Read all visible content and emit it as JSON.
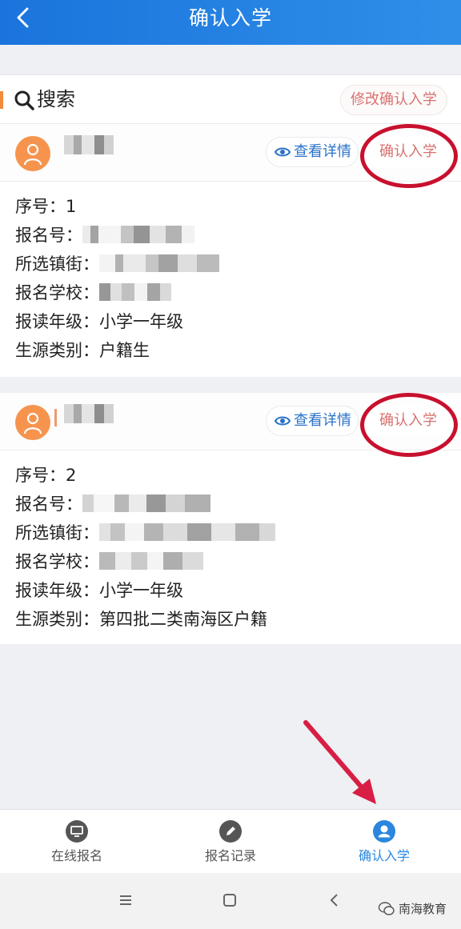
{
  "header": {
    "title": "确认入学"
  },
  "search": {
    "label": "搜索",
    "modify_button": "修改确认入学"
  },
  "cards": [
    {
      "details_button": "查看详情",
      "confirm_button": "确认入学",
      "fields": [
        {
          "label": "序号：",
          "value": "1"
        },
        {
          "label": "报名号：",
          "value": ""
        },
        {
          "label": "所选镇街：",
          "value": ""
        },
        {
          "label": "报名学校：",
          "value": ""
        },
        {
          "label": "报读年级：",
          "value": "小学一年级"
        },
        {
          "label": "生源类别：",
          "value": "户籍生"
        }
      ]
    },
    {
      "details_button": "查看详情",
      "confirm_button": "确认入学",
      "fields": [
        {
          "label": "序号：",
          "value": "2"
        },
        {
          "label": "报名号：",
          "value": ""
        },
        {
          "label": "所选镇街：",
          "value": ""
        },
        {
          "label": "报名学校：",
          "value": ""
        },
        {
          "label": "报读年级：",
          "value": "小学一年级"
        },
        {
          "label": "生源类别：",
          "value": "第四批二类南海区户籍"
        }
      ]
    }
  ],
  "tabbar": {
    "items": [
      {
        "label": "在线报名",
        "icon": "monitor-icon"
      },
      {
        "label": "报名记录",
        "icon": "pencil-icon"
      },
      {
        "label": "确认入学",
        "icon": "user-icon",
        "active": true
      }
    ]
  },
  "watermark": {
    "text": "南海教育"
  },
  "colors": {
    "header": "#1a74dc",
    "accent_red": "#d9706e",
    "highlight": "#c8102e",
    "active_tab": "#2a86de"
  }
}
